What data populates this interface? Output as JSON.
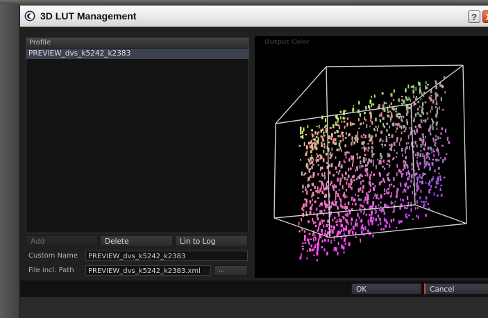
{
  "window": {
    "title": "3D LUT Management",
    "help_label": "?",
    "close_label": "X"
  },
  "profiles": {
    "header": "Profile",
    "rows": [
      "PREVIEW_dvs_k5242_k2383"
    ]
  },
  "actions": {
    "add_label": "Add",
    "delete_label": "Delete",
    "lin_to_log_label": "Lin to Log"
  },
  "form": {
    "custom_name_label": "Custom Name",
    "custom_name_value": "PREVIEW_dvs_k5242_k2383",
    "file_path_label": "File incl. Path",
    "file_path_value": "PREVIEW_dvs_k5242_k2383.xml",
    "browse_label": "..."
  },
  "viewer": {
    "caption": "Output Color"
  },
  "dialog": {
    "ok_label": "OK",
    "cancel_label": "Cancel"
  },
  "colors": {
    "title_bar": "#e9e9e9",
    "close_red": "#d9532f",
    "selection": "#3d4250",
    "cube_edge": "#cfcfcf"
  }
}
